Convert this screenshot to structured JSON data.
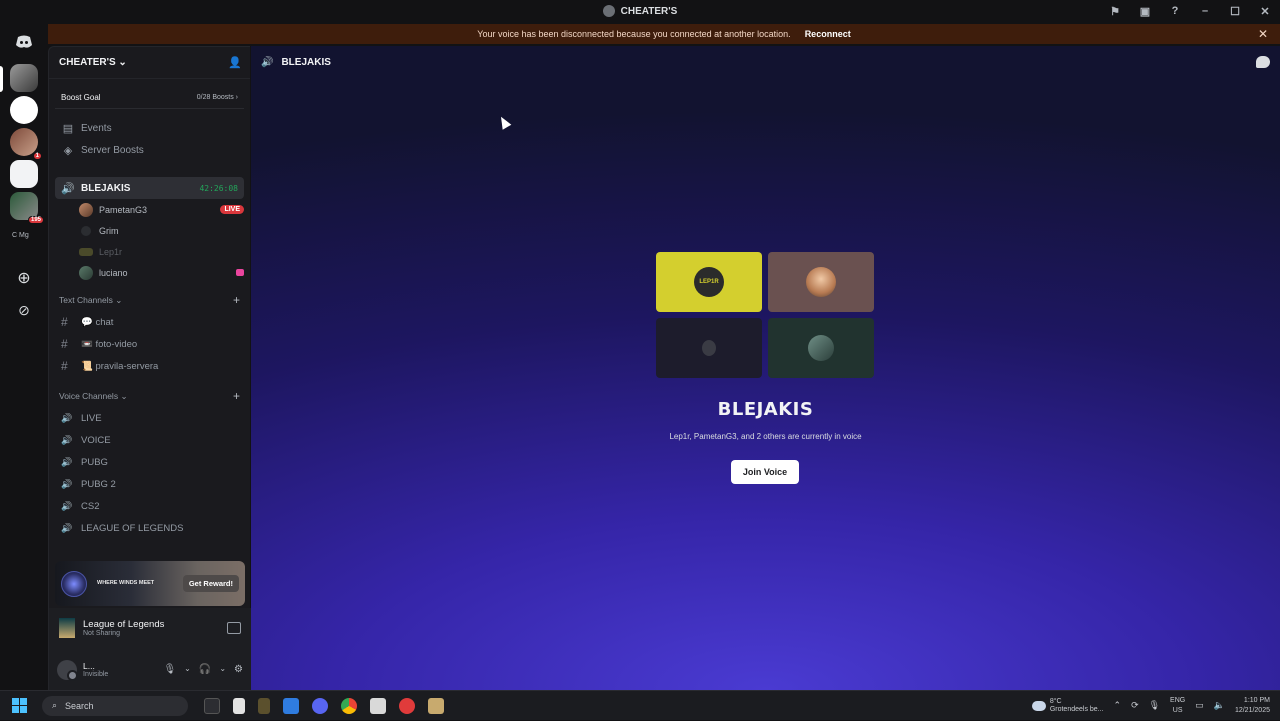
{
  "window": {
    "title": "CHEATER'S"
  },
  "notice": {
    "message": "Your voice has been disconnected because you connected at another location.",
    "action": "Reconnect",
    "close": "✕"
  },
  "rail": {
    "badges": {
      "server_two": "1",
      "server_five": "195"
    },
    "mini_labels": "C Mg"
  },
  "server": {
    "name": "CHEATER'S",
    "boost_goal_label": "Boost Goal",
    "boost_goal_count": "0/28 Boosts",
    "quick_links": [
      {
        "label": "Events"
      },
      {
        "label": "Server Boosts"
      }
    ]
  },
  "voice_active": {
    "name": "BLEJAKIS",
    "timer": "42:26:08",
    "members": [
      {
        "name": "PametanG3",
        "badge": "LIVE"
      },
      {
        "name": "Grim"
      },
      {
        "name": "Lep1r"
      },
      {
        "name": "luciano"
      }
    ]
  },
  "text_category": {
    "label": "Text Channels",
    "channels": [
      {
        "label": "💬 chat"
      },
      {
        "label": "📼 foto-video"
      },
      {
        "label": "📜 pravila-servera"
      }
    ]
  },
  "voice_category": {
    "label": "Voice Channels",
    "channels": [
      {
        "label": "LIVE"
      },
      {
        "label": "VOICE"
      },
      {
        "label": "PUBG"
      },
      {
        "label": "PUBG 2"
      },
      {
        "label": "CS2"
      },
      {
        "label": "LEAGUE OF LEGENDS"
      }
    ]
  },
  "promo": {
    "logo_text": "WHERE WINDS MEET",
    "button": "Get Reward!"
  },
  "activity": {
    "game": "League of Legends",
    "status": "Not Sharing"
  },
  "user": {
    "name": "L...",
    "status": "Invisible"
  },
  "main": {
    "header_channel": "BLEJAKIS",
    "channel_title": "BLEJAKIS",
    "subtitle": "Lep1r, PametanG3, and 2 others are currently in voice",
    "join_button": "Join Voice",
    "tile_label": "LEP1R"
  },
  "taskbar": {
    "search_placeholder": "Search",
    "weather_temp": "8°C",
    "weather_desc": "Grotendeels be...",
    "lang_top": "ENG",
    "lang_bottom": "US",
    "time": "1:10 PM",
    "date": "12/21/2025"
  },
  "colors": {
    "accent_green": "#23a55a",
    "live_red": "#da373c",
    "notice_bg": "#3e1d0c"
  }
}
